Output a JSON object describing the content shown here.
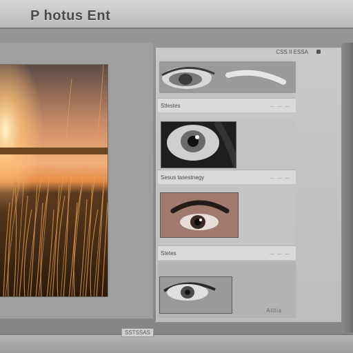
{
  "app": {
    "title": "P hotus Ent"
  },
  "panel": {
    "header_label": "CSS II ESSA",
    "close_icon": "close-icon"
  },
  "layers": [
    {
      "label": "Stlestes",
      "meta": "— — —"
    },
    {
      "label": "Sesus tasestnegy",
      "meta": "— — —"
    },
    {
      "label": "Stetes",
      "meta": "— — —"
    },
    {
      "label": "",
      "meta": "Alltis"
    }
  ],
  "status": {
    "text": "SSTSSAS"
  },
  "colors": {
    "titlebar": "#c8c8c8",
    "panel": "#c4c4c4",
    "accent_sunset": "#d97a2b"
  }
}
